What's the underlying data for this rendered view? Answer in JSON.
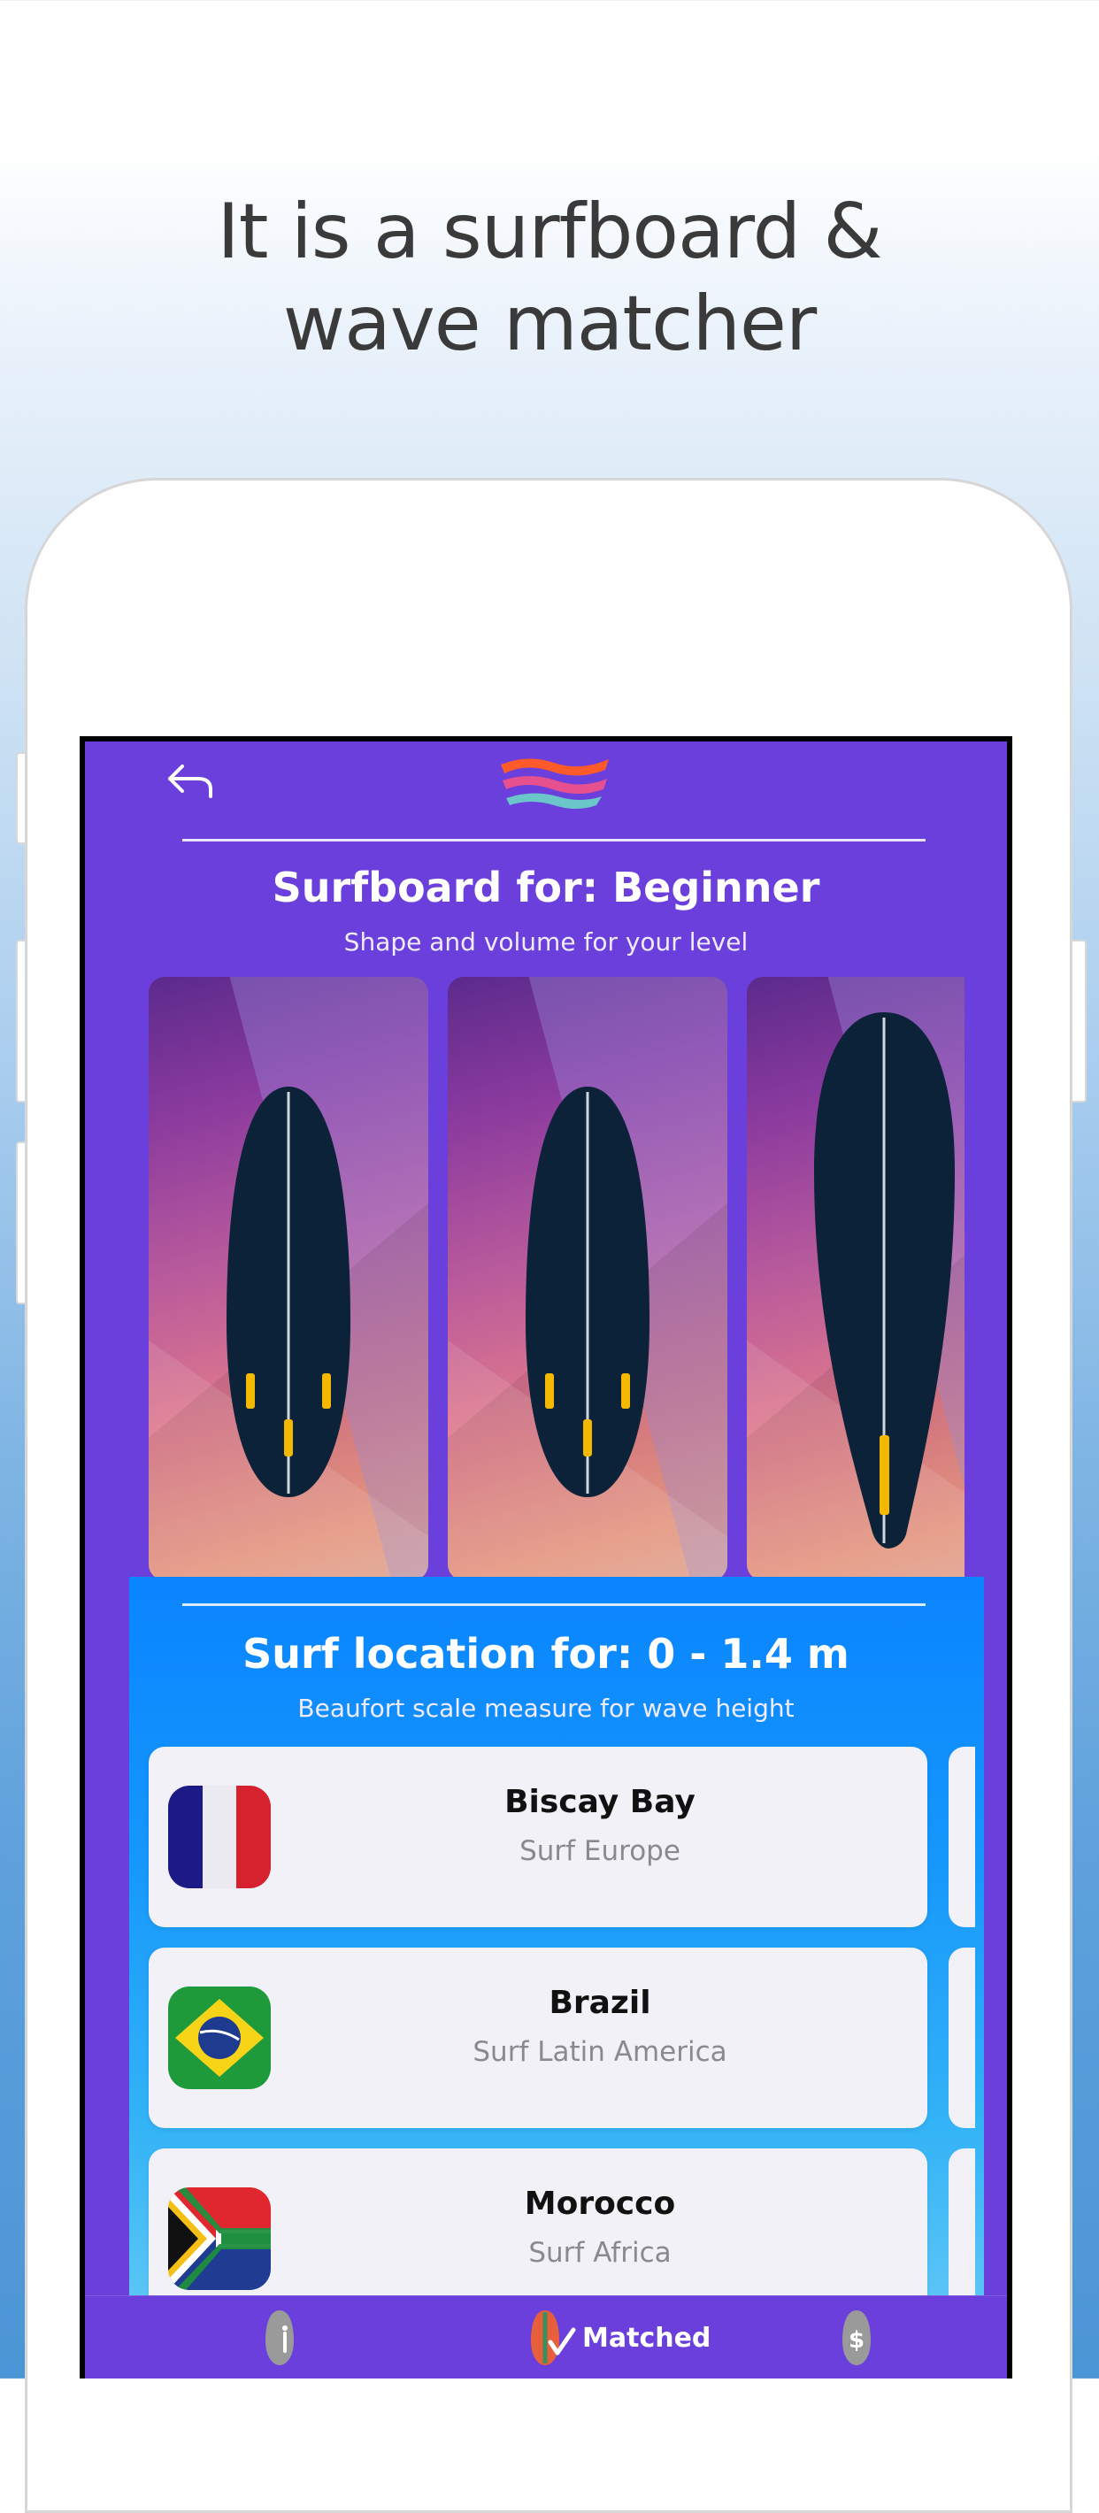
{
  "headline": {
    "line1": "It is a surfboard &",
    "line2": "wave matcher"
  },
  "app": {
    "header": {
      "back_icon": "back-arrow-icon",
      "logo_icon": "wave-logo-icon"
    },
    "surfboard_section": {
      "title": "Surfboard for: Beginner",
      "subtitle": "Shape and volume for your level",
      "boards": [
        "board-card-1",
        "board-card-2",
        "board-card-3"
      ]
    },
    "location_section": {
      "title": "Surf location for: 0 - 1.4 m",
      "subtitle": "Beaufort scale measure for wave height",
      "locations": [
        {
          "name": "Biscay Bay",
          "region": "Surf Europe",
          "flag": "france-flag-icon"
        },
        {
          "name": "Brazil",
          "region": "Surf Latin America",
          "flag": "brazil-flag-icon"
        },
        {
          "name": "Morocco",
          "region": "Surf Africa",
          "flag": "south-africa-flag-icon"
        }
      ]
    },
    "tabbar": {
      "tab_board_icon": "surfboard-icon",
      "tab_matched_icon": "matched-check-icon",
      "tab_matched_label": "Matched",
      "tab_price_icon": "dollar-board-icon"
    }
  },
  "colors": {
    "app_background": "#6a3fdc",
    "location_gradient_top": "#0a84ff",
    "card_background": "#f2f1f7",
    "board_color": "#0b2238",
    "fin_color": "#f5b800"
  }
}
